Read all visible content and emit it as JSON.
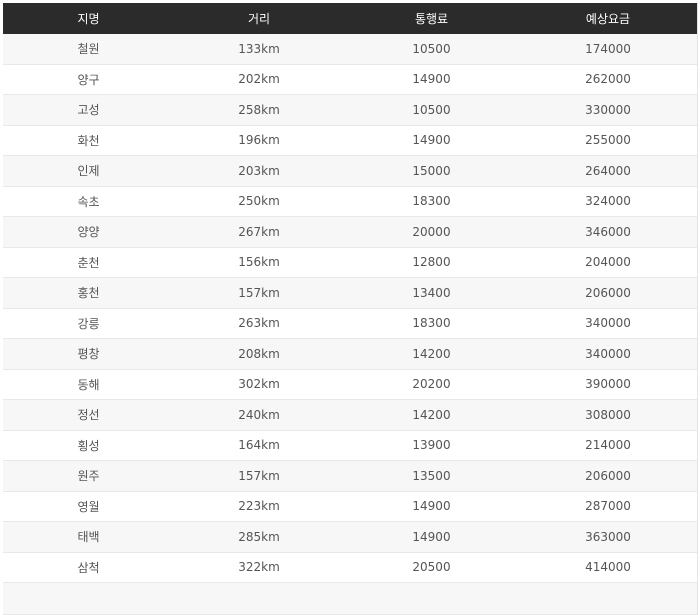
{
  "table": {
    "headers": [
      "지명",
      "거리",
      "통행료",
      "예상요금"
    ],
    "rows": [
      [
        "철원",
        "133km",
        "10500",
        "174000"
      ],
      [
        "양구",
        "202km",
        "14900",
        "262000"
      ],
      [
        "고성",
        "258km",
        "10500",
        "330000"
      ],
      [
        "화천",
        "196km",
        "14900",
        "255000"
      ],
      [
        "인제",
        "203km",
        "15000",
        "264000"
      ],
      [
        "속초",
        "250km",
        "18300",
        "324000"
      ],
      [
        "양양",
        "267km",
        "20000",
        "346000"
      ],
      [
        "춘천",
        "156km",
        "12800",
        "204000"
      ],
      [
        "홍천",
        "157km",
        "13400",
        "206000"
      ],
      [
        "강릉",
        "263km",
        "18300",
        "340000"
      ],
      [
        "평창",
        "208km",
        "14200",
        "340000"
      ],
      [
        "동해",
        "302km",
        "20200",
        "390000"
      ],
      [
        "정선",
        "240km",
        "14200",
        "308000"
      ],
      [
        "횡성",
        "164km",
        "13900",
        "214000"
      ],
      [
        "원주",
        "157km",
        "13500",
        "206000"
      ],
      [
        "영월",
        "223km",
        "14900",
        "287000"
      ],
      [
        "태백",
        "285km",
        "14900",
        "363000"
      ],
      [
        "삼척",
        "322km",
        "20500",
        "414000"
      ]
    ]
  },
  "colors": {
    "header_bg": "#2b2b2b",
    "header_text": "#ffffff",
    "row_alt_bg": "#f7f7f7",
    "row_bg": "#ffffff",
    "border": "#e8e8e8",
    "text": "#555555"
  }
}
